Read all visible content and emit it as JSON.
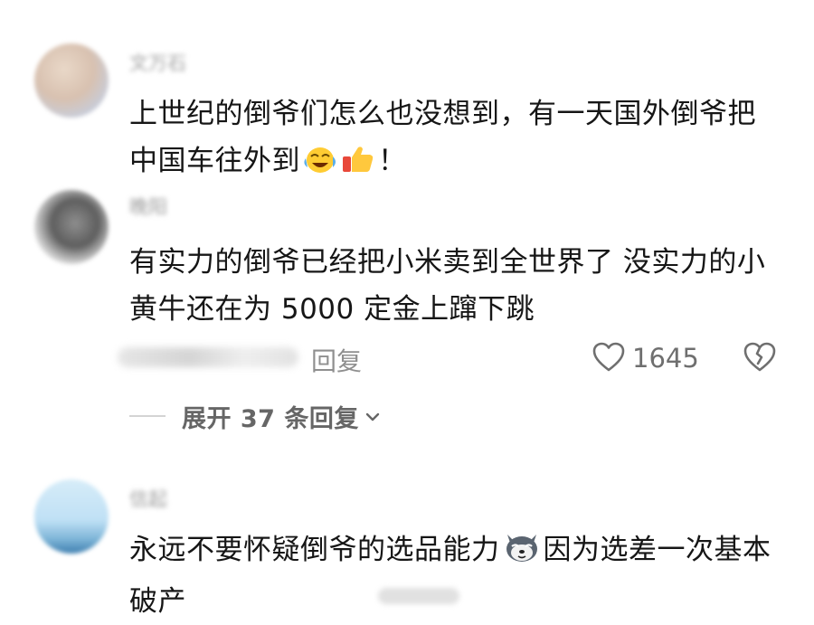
{
  "comments": [
    {
      "username": "文万石",
      "content_before_emoji": "上世纪的倒爷们怎么也没想到，有一天国外倒爷把中国车往外到",
      "content_after_emoji": "！",
      "emojis": [
        "crying-laughing-emoji",
        "thumbs-up-emoji"
      ]
    },
    {
      "username": "晚阳",
      "content": "有实力的倒爷已经把小米卖到全世界了 没实力的小黄牛还在为 5000 定金上蹿下跳",
      "reply_label": "回复",
      "like_count": "1645",
      "expand_label": "展开 37 条回复"
    },
    {
      "username": "信起",
      "content_before_emoji": "永远不要怀疑倒爷的选品能力",
      "content_after_emoji": "因为选差一次基本破产",
      "emojis": [
        "husky-dog-emoji"
      ]
    }
  ],
  "colors": {
    "text": "#161616",
    "meta": "#8f8f8f",
    "expand": "#666666"
  }
}
